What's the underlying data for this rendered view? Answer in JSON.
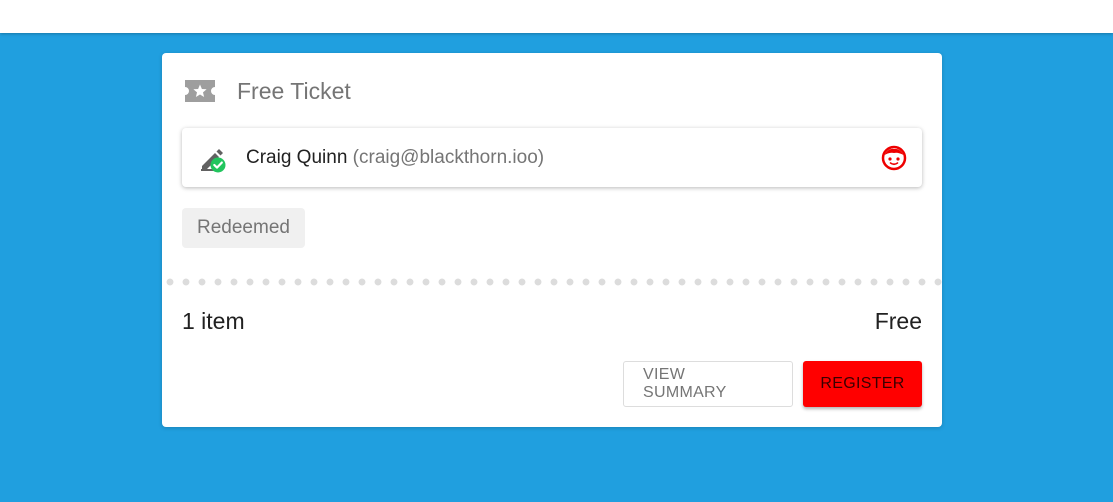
{
  "card": {
    "title": "Free Ticket",
    "ticket_icon": "ticket-star-icon",
    "attendee": {
      "status_icon": "edit-check-icon",
      "name": "Craig Quinn",
      "email": "(craig@blackthorn.ioo)",
      "avatar_icon": "face-avatar-icon"
    },
    "status_chip": "Redeemed",
    "summary": {
      "count": "1 item",
      "price": "Free"
    },
    "actions": {
      "view_summary": "VIEW SUMMARY",
      "register": "REGISTER"
    }
  },
  "colors": {
    "background": "#209fdf",
    "accent": "#ff0000",
    "success": "#22c55e"
  }
}
